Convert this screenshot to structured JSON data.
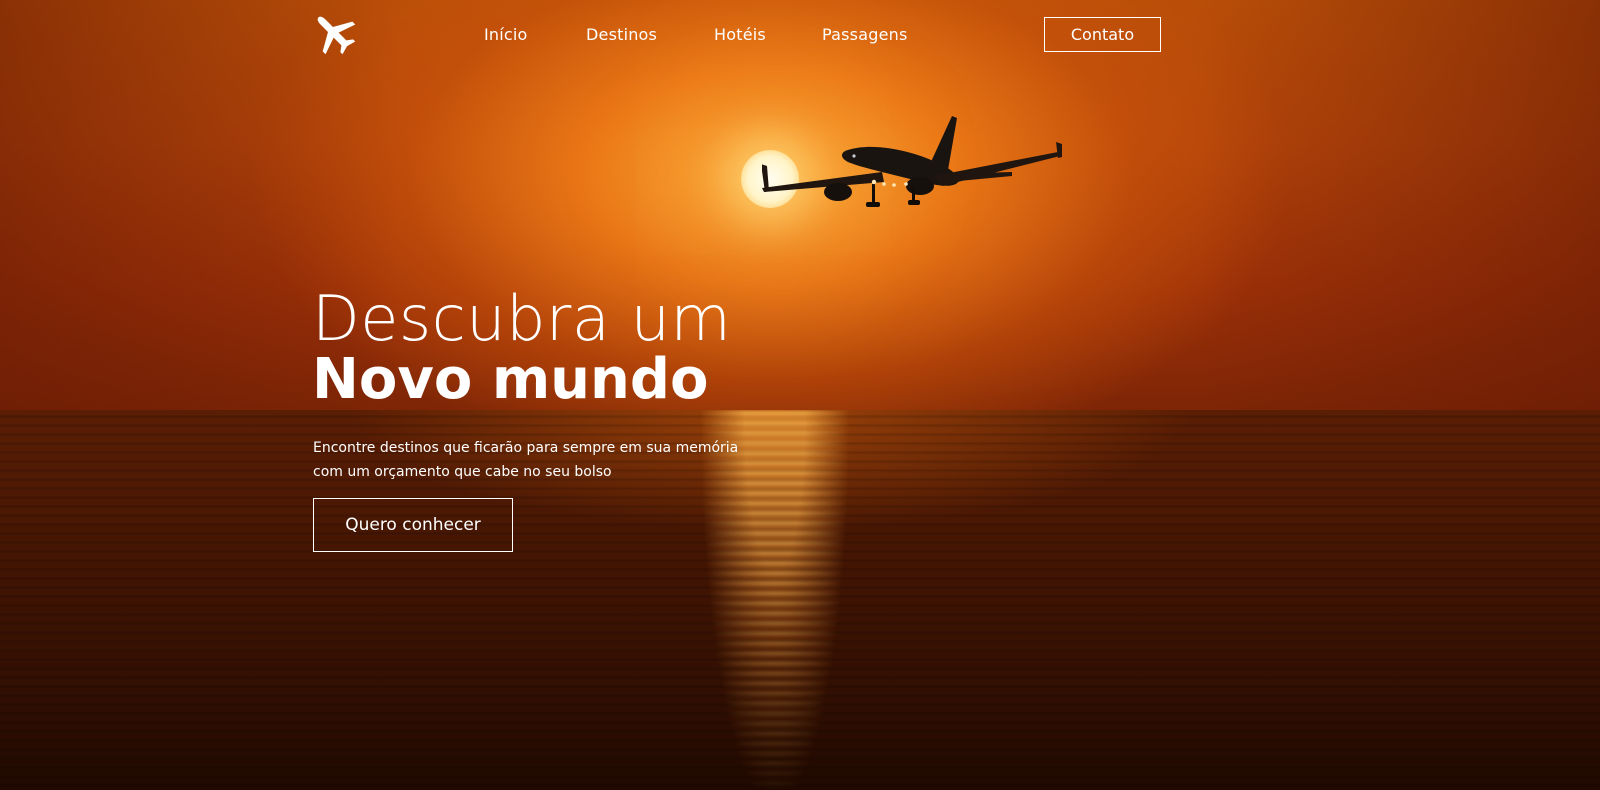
{
  "nav": {
    "logo_icon": "airplane-icon",
    "links": [
      {
        "label": "Início"
      },
      {
        "label": "Destinos"
      },
      {
        "label": "Hotéis"
      },
      {
        "label": "Passagens"
      }
    ],
    "contact_label": "Contato"
  },
  "hero": {
    "headline_light": "Descubra um",
    "headline_bold": "Novo mundo",
    "subtext_line1": "Encontre destinos que ficarão para sempre em sua memória",
    "subtext_line2": "com um orçamento que cabe no seu bolso",
    "cta_label": "Quero conhecer",
    "background_image": "sunset-ocean-airplane",
    "colors": {
      "sky": "#b3440a",
      "sun_glow": "#ffb23c",
      "sea": "#431503",
      "text": "#ffffff"
    }
  }
}
